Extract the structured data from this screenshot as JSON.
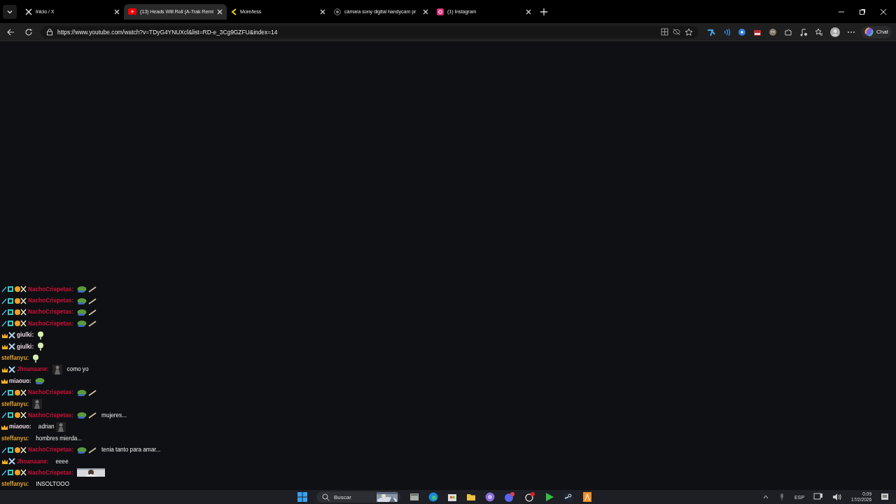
{
  "tabs": [
    {
      "title": "Inicio / X",
      "selected": false
    },
    {
      "title": "(13) Heads Will Roll (A-Trak Remi",
      "selected": true
    },
    {
      "title": "More/less",
      "selected": false
    },
    {
      "title": "cámara sony digital handycam pr",
      "selected": false
    },
    {
      "title": "(1) Instagram",
      "selected": false
    }
  ],
  "address_bar": {
    "url": "https://www.youtube.com/watch?v=TDyG4YNUXcl&list=RD-e_3Cg9GZFU&index=14"
  },
  "copilot_button": {
    "label": "Chat"
  },
  "chat": [
    {
      "user": "NachoCrispetas:",
      "color": "#d0103a",
      "kind": "sword",
      "parts": [
        {
          "kind": "frog"
        },
        {
          "kind": "stick"
        }
      ]
    },
    {
      "user": "NachoCrispetas:",
      "color": "#d0103a",
      "kind": "sword",
      "parts": [
        {
          "kind": "frog"
        },
        {
          "kind": "stick"
        }
      ]
    },
    {
      "user": "NachoCrispetas:",
      "color": "#d0103a",
      "kind": "sword",
      "parts": [
        {
          "kind": "frog"
        },
        {
          "kind": "stick"
        }
      ]
    },
    {
      "user": "NachoCrispetas:",
      "color": "#d0103a",
      "kind": "sword",
      "parts": [
        {
          "kind": "frog"
        },
        {
          "kind": "stick"
        }
      ]
    },
    {
      "user": "giulki:",
      "color": "#e8d6e0",
      "kind": "duo",
      "parts": [
        {
          "kind": "bulb"
        }
      ]
    },
    {
      "user": "giulki:",
      "color": "#e8d6e0",
      "kind": "duo",
      "parts": [
        {
          "kind": "bulb"
        }
      ]
    },
    {
      "user": "steffanyu:",
      "color": "#e0a030",
      "kind": "plain",
      "parts": [
        {
          "kind": "bulb"
        }
      ]
    },
    {
      "user": "Jhoanaane:",
      "color": "#d0103a",
      "kind": "duo",
      "parts": [
        {
          "kind": "figure"
        },
        {
          "kind": "text",
          "text": "como yo"
        }
      ]
    },
    {
      "user": "miaouo:",
      "color": "#e8d6e0",
      "kind": "crown",
      "parts": [
        {
          "kind": "frog"
        }
      ]
    },
    {
      "user": "NachoCrispetas:",
      "color": "#d0103a",
      "kind": "sword",
      "parts": [
        {
          "kind": "frog"
        },
        {
          "kind": "stick"
        }
      ]
    },
    {
      "user": "steffanyu:",
      "color": "#e0a030",
      "kind": "plain",
      "parts": [
        {
          "kind": "figure"
        }
      ]
    },
    {
      "user": "NachoCrispetas:",
      "color": "#d0103a",
      "kind": "sword",
      "parts": [
        {
          "kind": "frog"
        },
        {
          "kind": "stick"
        },
        {
          "kind": "text",
          "text": "mujeres..."
        }
      ]
    },
    {
      "user": "miaouo:",
      "color": "#e8d6e0",
      "kind": "crown",
      "parts": [
        {
          "kind": "text",
          "text": "adrian"
        },
        {
          "kind": "figure"
        }
      ]
    },
    {
      "user": "steffanyu:",
      "color": "#e0a030",
      "kind": "plain",
      "parts": [
        {
          "kind": "text",
          "text": "hombres mierda..."
        }
      ]
    },
    {
      "user": "NachoCrispetas:",
      "color": "#d0103a",
      "kind": "sword",
      "parts": [
        {
          "kind": "frog"
        },
        {
          "kind": "stick"
        },
        {
          "kind": "text",
          "text": "tenia tanto para amar..."
        }
      ]
    },
    {
      "user": "Jhoanaane:",
      "color": "#d0103a",
      "kind": "duo",
      "parts": [
        {
          "kind": "text",
          "text": "eeee"
        }
      ]
    },
    {
      "user": "NachoCrispetas:",
      "color": "#d0103a",
      "kind": "sword"
    },
    {
      "user": "steffanyu:",
      "color": "#e0a030",
      "kind": "plain",
      "parts": [
        {
          "kind": "text",
          "text": "INSOLTOOO"
        }
      ]
    }
  ],
  "taskbar": {
    "search_placeholder": "Buscar",
    "language": "ESP",
    "time": "0:09",
    "date": "17/2/2026"
  }
}
